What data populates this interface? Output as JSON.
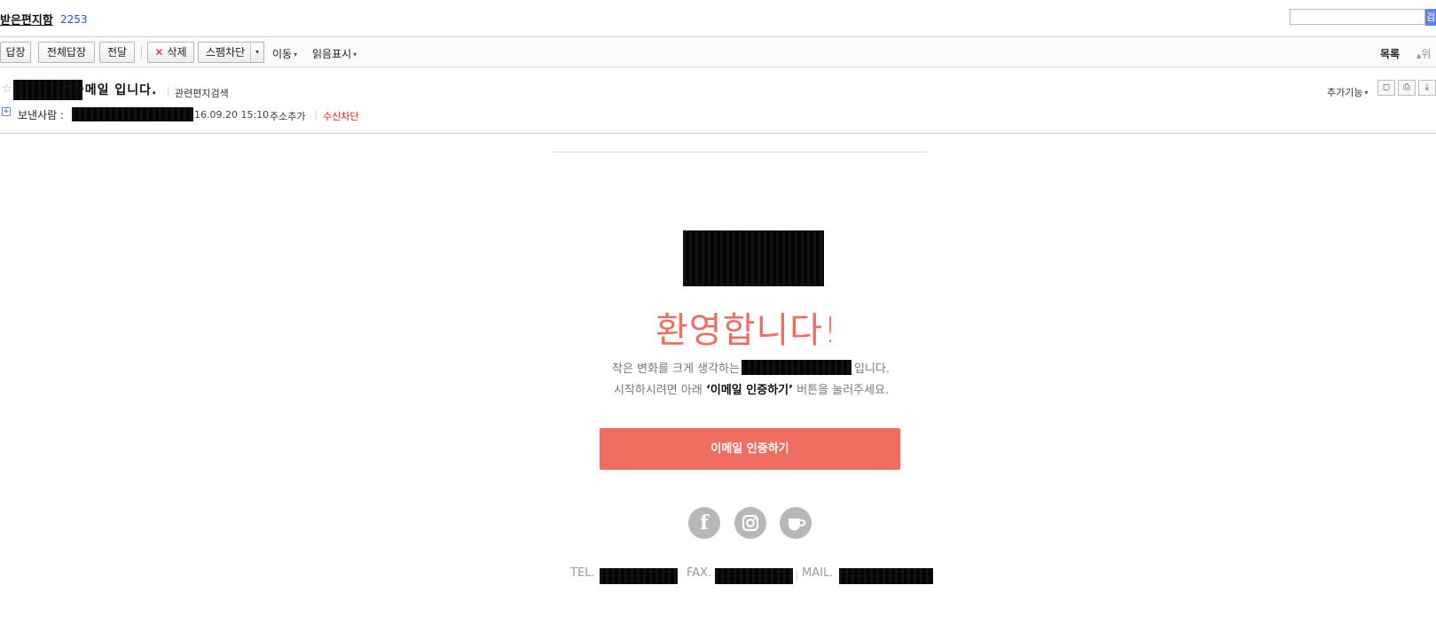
{
  "header": {
    "folder_name": "받은편지함",
    "unread_count": "2253",
    "search_button_label": "검"
  },
  "toolbar": {
    "reply": "답장",
    "reply_all": "전체답장",
    "forward": "전달",
    "delete": "삭제",
    "delete_icon": "✕",
    "spam_block": "스팸차단",
    "move": "이동",
    "mark_read": "읽음표시",
    "list": "목록",
    "up": "위"
  },
  "message": {
    "subject": "인증메일 입니다.",
    "related_search": "관련편지검색",
    "more_features": "추가기능",
    "sender_label": "보낸사람 :",
    "date": "16.09.20 15:10",
    "add_address": "주소추가",
    "block_receive": "수신차단"
  },
  "email_body": {
    "welcome": "환영합니다!",
    "line1_before": "작은 변화를 크게 생각하는",
    "line1_after": "입니다.",
    "line2_before": "시작하시려면 아래",
    "line2_highlight": "‘이메일 인증하기’",
    "line2_after": "버튼을 눌러주세요.",
    "verify_button": "이메일 인증하기",
    "social_icons": [
      "facebook-icon",
      "instagram-icon",
      "cafe-icon"
    ],
    "tel_label": "TEL.",
    "fax_label": "FAX.",
    "mail_label": "MAIL."
  },
  "colors": {
    "accent": "#f06d62",
    "link_blue": "#2a4bd7",
    "danger": "#e61616",
    "social_gray": "#b7b7b7"
  }
}
